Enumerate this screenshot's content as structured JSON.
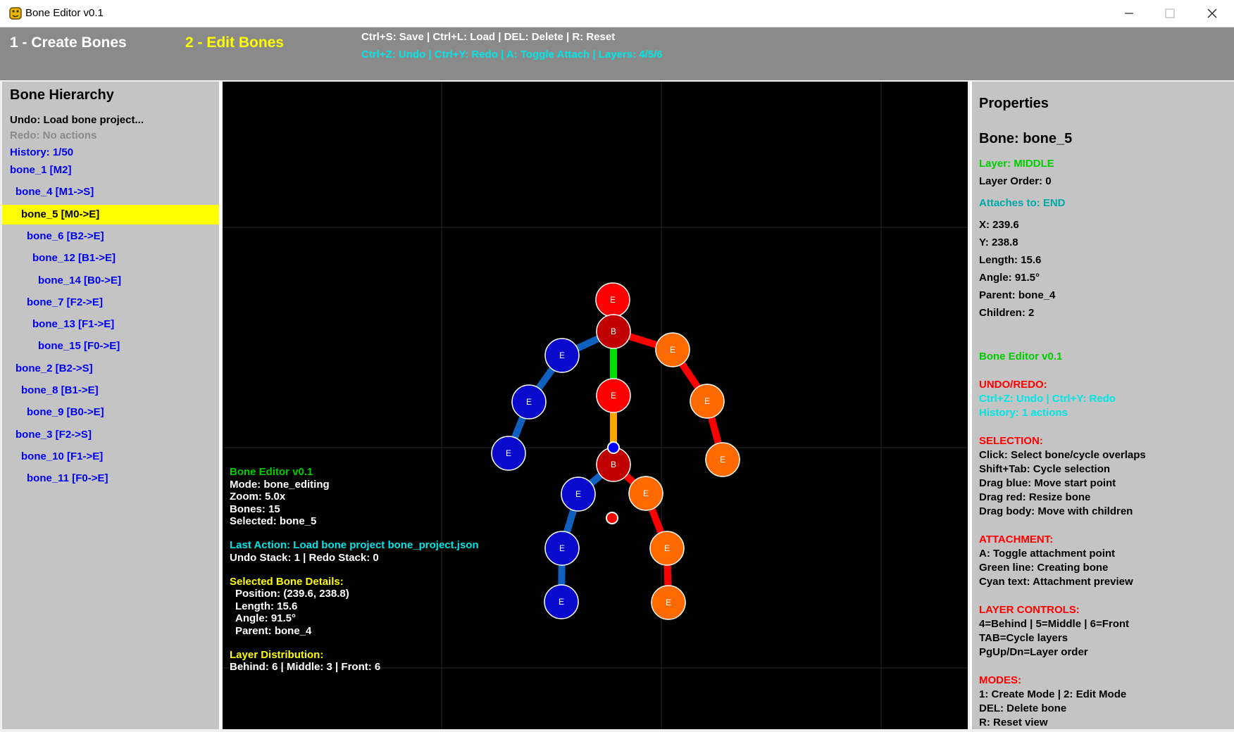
{
  "window": {
    "title": "Bone Editor v0.1"
  },
  "toolbar": {
    "mode1": "1 - Create Bones",
    "mode2": "2 - Edit Bones",
    "hint1": "Ctrl+S: Save | Ctrl+L: Load | DEL: Delete | R: Reset",
    "hint2": "Ctrl+Z: Undo | Ctrl+Y: Redo | A: Toggle Attach | Layers: 4/5/6"
  },
  "hierarchy": {
    "title": "Bone Hierarchy",
    "undo": "Undo: Load bone project...",
    "redo": "Redo: No actions",
    "history": "History: 1/50",
    "items": [
      {
        "label": "bone_1 [M2]",
        "depth": 0,
        "selected": false
      },
      {
        "label": "bone_4 [M1->S]",
        "depth": 1,
        "selected": false
      },
      {
        "label": "bone_5 [M0->E]",
        "depth": 2,
        "selected": true
      },
      {
        "label": "bone_6 [B2->E]",
        "depth": 3,
        "selected": false
      },
      {
        "label": "bone_12 [B1->E]",
        "depth": 4,
        "selected": false
      },
      {
        "label": "bone_14 [B0->E]",
        "depth": 5,
        "selected": false
      },
      {
        "label": "bone_7 [F2->E]",
        "depth": 3,
        "selected": false
      },
      {
        "label": "bone_13 [F1->E]",
        "depth": 4,
        "selected": false
      },
      {
        "label": "bone_15 [F0->E]",
        "depth": 5,
        "selected": false
      },
      {
        "label": "bone_2 [B2->S]",
        "depth": 1,
        "selected": false
      },
      {
        "label": "bone_8 [B1->E]",
        "depth": 2,
        "selected": false
      },
      {
        "label": "bone_9 [B0->E]",
        "depth": 3,
        "selected": false
      },
      {
        "label": "bone_3 [F2->S]",
        "depth": 1,
        "selected": false
      },
      {
        "label": "bone_10 [F1->E]",
        "depth": 2,
        "selected": false
      },
      {
        "label": "bone_11 [F0->E]",
        "depth": 3,
        "selected": false
      }
    ]
  },
  "overlay": {
    "title": "Bone Editor v0.1",
    "mode": "Mode: bone_editing",
    "zoom": "Zoom: 5.0x",
    "bones": "Bones: 15",
    "selected": "Selected: bone_5",
    "last_action": "Last Action: Load bone project bone_project.json",
    "stack": "Undo Stack: 1 | Redo Stack: 0",
    "details_title": "Selected Bone Details:",
    "position": "Position: (239.6, 238.8)",
    "length": "Length: 15.6",
    "angle": "Angle: 91.5°",
    "parent": "Parent: bone_4",
    "layer_title": "Layer Distribution:",
    "layer_counts": "Behind: 6 | Middle: 3 | Front: 6"
  },
  "properties": {
    "title": "Properties",
    "bone": "Bone: bone_5",
    "layer": "Layer: MIDDLE",
    "layer_order": "Layer Order: 0",
    "attaches": "Attaches to: END",
    "x": "X: 239.6",
    "y": "Y: 238.8",
    "length": "Length: 15.6",
    "angle": "Angle: 91.5°",
    "parent": "Parent: bone_4",
    "children": "Children: 2",
    "app": "Bone Editor v0.1",
    "undo_title": "UNDO/REDO:",
    "undo_keys": "Ctrl+Z: Undo | Ctrl+Y: Redo",
    "history": "History: 1 actions",
    "sel_title": "SELECTION:",
    "sel_lines": [
      "Click: Select bone/cycle overlaps",
      "Shift+Tab: Cycle selection",
      "Drag blue: Move start point",
      "Drag red: Resize bone",
      "Drag body: Move with children"
    ],
    "att_title": "ATTACHMENT:",
    "att_lines": [
      "A: Toggle attachment point",
      "Green line: Creating bone",
      "Cyan text: Attachment preview"
    ],
    "layer_title": "LAYER CONTROLS:",
    "layer_lines": [
      "4=Behind | 5=Middle | 6=Front",
      "TAB=Cycle layers",
      "PgUp/Dn=Layer order"
    ],
    "modes_title": "MODES:",
    "modes_lines": [
      "1: Create Mode | 2: Edit Mode",
      "DEL: Delete bone",
      "R: Reset view"
    ]
  },
  "joint_labels": {
    "begin": "B",
    "end": "E"
  },
  "colors": {
    "behind": "#0a0acc",
    "middle": "#ff0000",
    "front": "#ff6a00",
    "selected_bone": "#ffa500",
    "creating_line": "#00dd00",
    "limb_blue": "#1060c0",
    "root_joint": "#c00000"
  }
}
